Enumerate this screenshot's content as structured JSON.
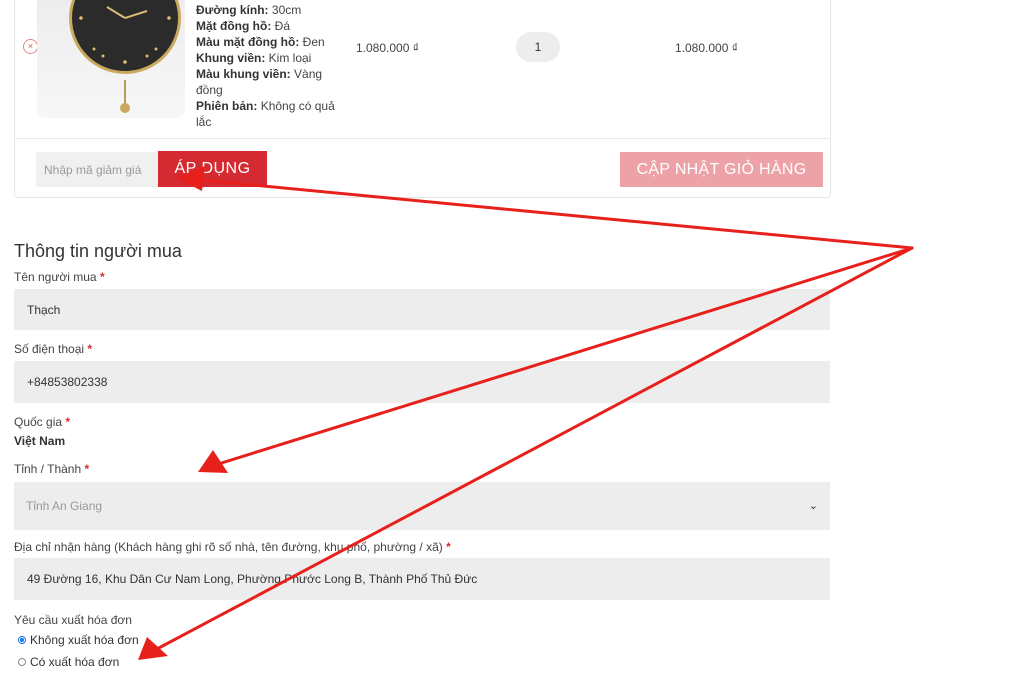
{
  "cart": {
    "item": {
      "attributes": [
        {
          "label": "Đường kính:",
          "value": "30cm"
        },
        {
          "label": "Mặt đồng hồ:",
          "value": "Đá"
        },
        {
          "label": "Màu mặt đồng hồ:",
          "value": "Đen"
        },
        {
          "label": "Khung viền:",
          "value": "Kim loại"
        },
        {
          "label": "Màu khung viền:",
          "value": "Vàng đồng"
        },
        {
          "label": "Phiên bản:",
          "value": "Không có quả lắc"
        }
      ],
      "price": "1.080.000 ₫",
      "quantity": "1",
      "subtotal": "1.080.000 ₫",
      "remove_icon": "×"
    },
    "coupon_placeholder": "Nhập mã giảm giá",
    "apply_label": "ÁP DỤNG",
    "update_label": "CẬP NHẬT GIỎ HÀNG"
  },
  "buyer": {
    "title": "Thông tin người mua",
    "name": {
      "label": "Tên người mua",
      "value": "Thạch"
    },
    "phone": {
      "label": "Số điện thoại",
      "value": "+84853802338"
    },
    "country": {
      "label": "Quốc gia",
      "value": "Việt Nam"
    },
    "province": {
      "label": "Tỉnh / Thành",
      "value": "Tỉnh An Giang",
      "chevron": "⌄"
    },
    "address": {
      "label": "Địa chỉ nhận hàng (Khách hàng ghi rõ số nhà, tên đường, khu phố, phường / xã)",
      "value": "49 Đường 16, Khu Dân Cư Nam Long, Phường Phước Long B, Thành Phố Thủ Đức"
    },
    "invoice": {
      "label": "Yêu cầu xuất hóa đơn",
      "options": [
        {
          "label": "Không xuất hóa đơn",
          "checked": true
        },
        {
          "label": "Có xuất hóa đơn",
          "checked": false
        }
      ]
    },
    "required_mark": "*"
  },
  "colors": {
    "accent": "#d42b32",
    "update_button": "#eca2a6",
    "annotation_arrow": "#e8201c"
  }
}
